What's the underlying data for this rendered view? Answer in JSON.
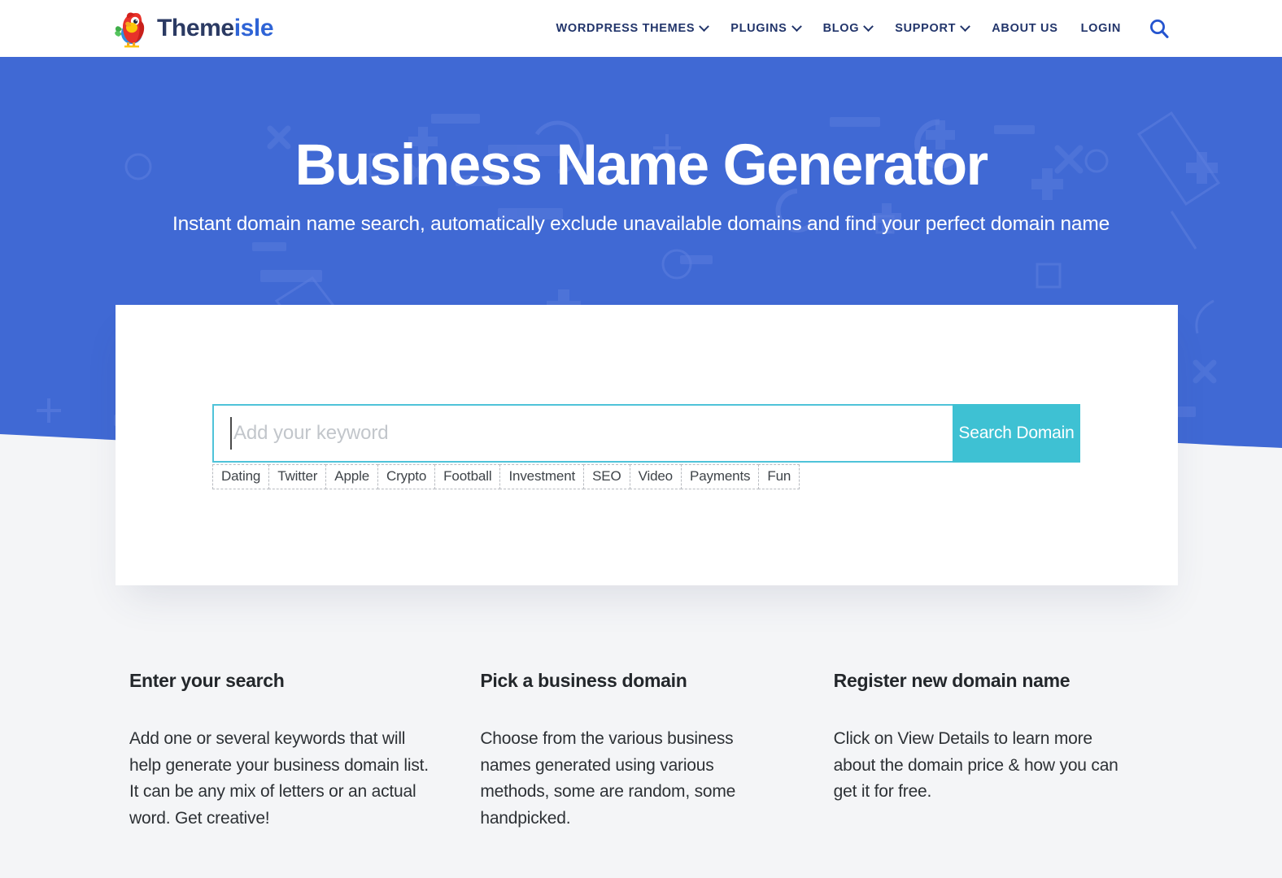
{
  "header": {
    "logo": {
      "icon": "parrot-logo-icon",
      "text_dark": "Theme",
      "text_accent": "isle"
    },
    "nav": [
      {
        "label": "WORDPRESS THEMES",
        "has_caret": true,
        "name": "wordpress-themes"
      },
      {
        "label": "PLUGINS",
        "has_caret": true,
        "name": "plugins"
      },
      {
        "label": "BLOG",
        "has_caret": true,
        "name": "blog"
      },
      {
        "label": "SUPPORT",
        "has_caret": true,
        "name": "support"
      },
      {
        "label": "ABOUT US",
        "has_caret": false,
        "name": "about-us"
      },
      {
        "label": "LOGIN",
        "has_caret": false,
        "name": "login"
      }
    ],
    "search_icon": "search-icon"
  },
  "hero": {
    "title": "Business Name Generator",
    "subtitle": "Instant domain name search, automatically exclude unavailable domains and find your perfect domain name"
  },
  "search": {
    "value": "",
    "placeholder": "Add your keyword",
    "button_label": "Search Domain",
    "tags": [
      "Dating",
      "Twitter",
      "Apple",
      "Crypto",
      "Football",
      "Investment",
      "SEO",
      "Video",
      "Payments",
      "Fun"
    ]
  },
  "info_columns": [
    {
      "title": "Enter your search",
      "body": "Add one or several keywords that will help generate your business domain list. It can be any mix of letters or an actual word. Get creative!"
    },
    {
      "title": "Pick a business domain",
      "body": "Choose from the various business names generated using various methods, some are random, some handpicked."
    },
    {
      "title": "Register new domain name",
      "body": "Click on View Details to learn more about the domain price & how you can get it for free."
    }
  ],
  "colors": {
    "hero_blue": "#4069d4",
    "teal": "#3ec1d3",
    "nav_navy": "#22356b",
    "logo_accent": "#2f64d6",
    "page_bg": "#f4f5f7"
  }
}
